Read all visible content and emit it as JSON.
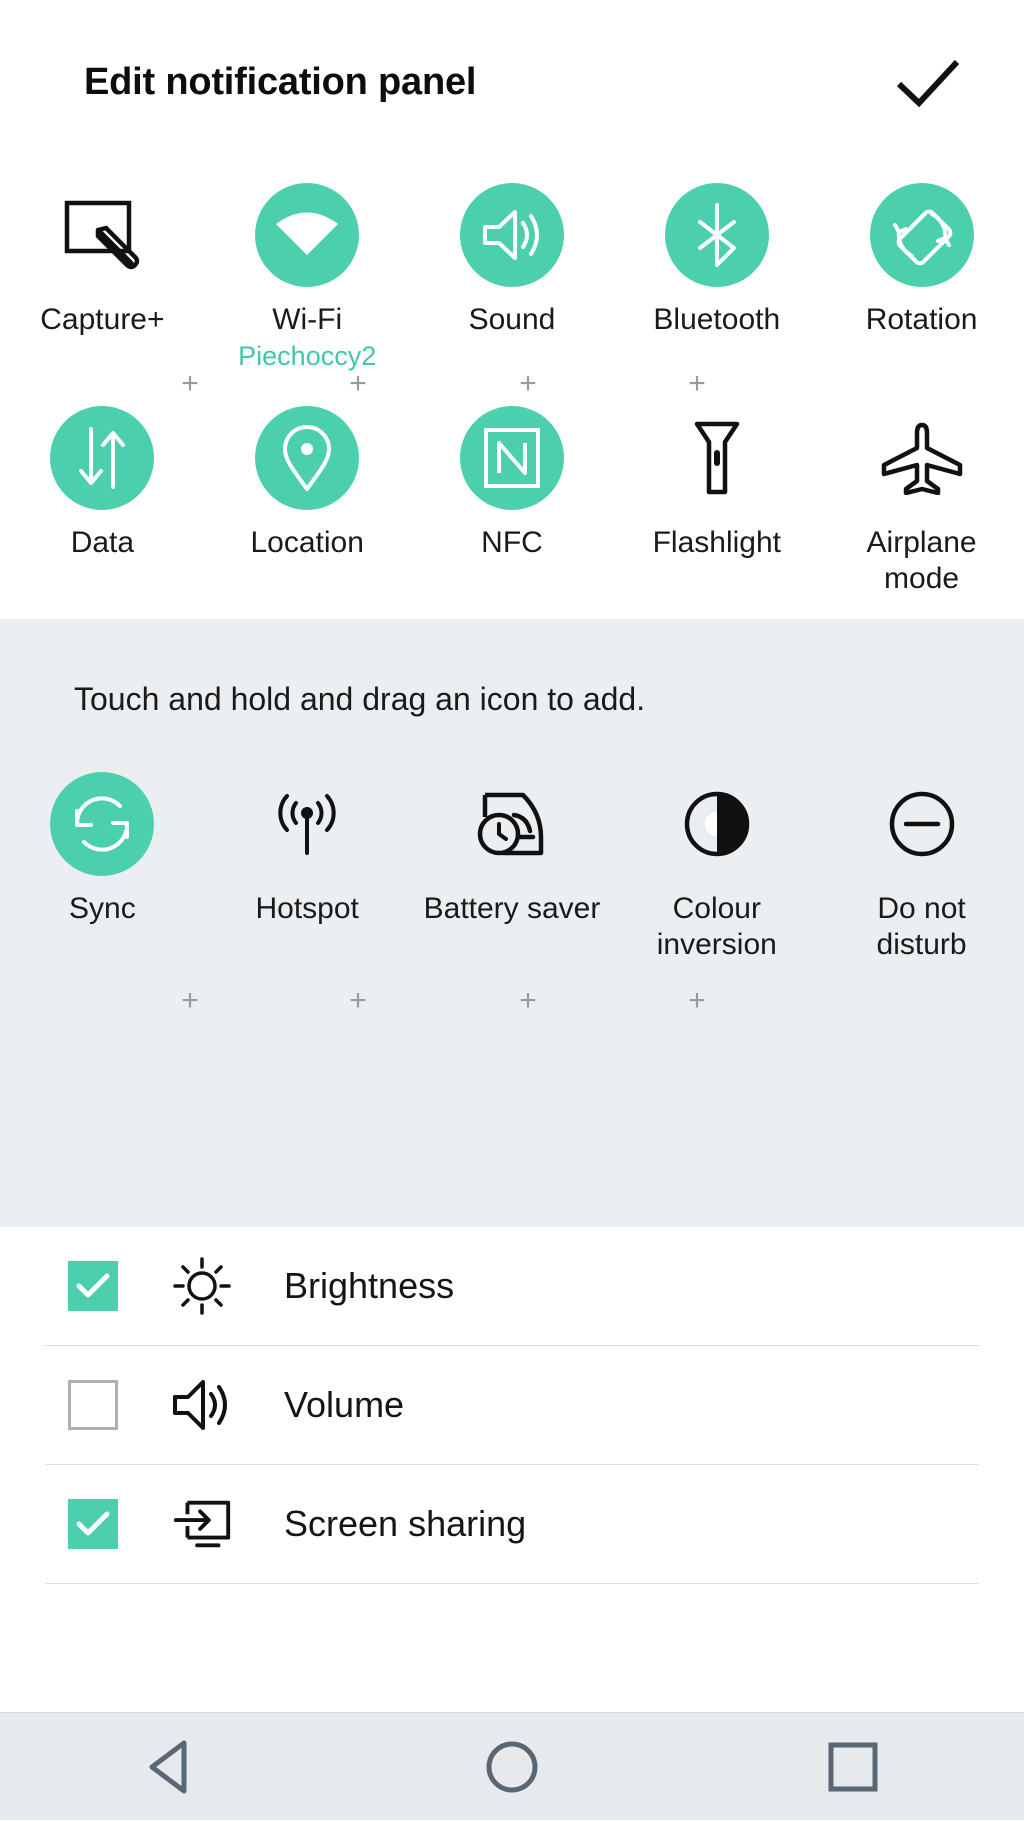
{
  "header": {
    "title": "Edit notification panel",
    "done_icon": "check-icon"
  },
  "colors": {
    "accent": "#4ccfad",
    "accent_text": "#3fc9a6",
    "gray_section_bg": "#eceff1",
    "navbar_bg": "#e6eaec",
    "nav_icon": "#5a6772"
  },
  "active_tiles": {
    "row1": [
      {
        "label": "Capture+",
        "icon": "capture-plus-icon",
        "state": "off",
        "sublabel": ""
      },
      {
        "label": "Wi-Fi",
        "icon": "wifi-icon",
        "state": "on",
        "sublabel": "Piechoccy2"
      },
      {
        "label": "Sound",
        "icon": "sound-icon",
        "state": "on",
        "sublabel": ""
      },
      {
        "label": "Bluetooth",
        "icon": "bluetooth-icon",
        "state": "on",
        "sublabel": ""
      },
      {
        "label": "Rotation",
        "icon": "rotation-icon",
        "state": "on",
        "sublabel": ""
      }
    ],
    "row2": [
      {
        "label": "Data",
        "icon": "data-icon",
        "state": "on",
        "sublabel": ""
      },
      {
        "label": "Location",
        "icon": "location-icon",
        "state": "on",
        "sublabel": ""
      },
      {
        "label": "NFC",
        "icon": "nfc-icon",
        "state": "on",
        "sublabel": ""
      },
      {
        "label": "Flashlight",
        "icon": "flashlight-icon",
        "state": "off",
        "sublabel": ""
      },
      {
        "label": "Airplane mode",
        "icon": "airplane-icon",
        "state": "off",
        "sublabel": ""
      }
    ],
    "plus_marker": "+"
  },
  "available": {
    "hint": "Touch and hold and drag an icon to add.",
    "tiles": [
      {
        "label": "Sync",
        "icon": "sync-icon",
        "state": "on"
      },
      {
        "label": "Hotspot",
        "icon": "hotspot-icon",
        "state": "off"
      },
      {
        "label": "Battery saver",
        "icon": "battery-saver-icon",
        "state": "off"
      },
      {
        "label": "Colour inversion",
        "icon": "colour-inversion-icon",
        "state": "off"
      },
      {
        "label": "Do not disturb",
        "icon": "do-not-disturb-icon",
        "state": "off"
      }
    ],
    "plus_marker": "+"
  },
  "list": [
    {
      "label": "Brightness",
      "icon": "brightness-icon",
      "checked": true
    },
    {
      "label": "Volume",
      "icon": "volume-icon",
      "checked": false
    },
    {
      "label": "Screen sharing",
      "icon": "screen-sharing-icon",
      "checked": true
    }
  ],
  "navbar": [
    {
      "name": "back",
      "icon": "back-triangle-icon"
    },
    {
      "name": "home",
      "icon": "home-circle-icon"
    },
    {
      "name": "recents",
      "icon": "recents-square-icon"
    }
  ]
}
